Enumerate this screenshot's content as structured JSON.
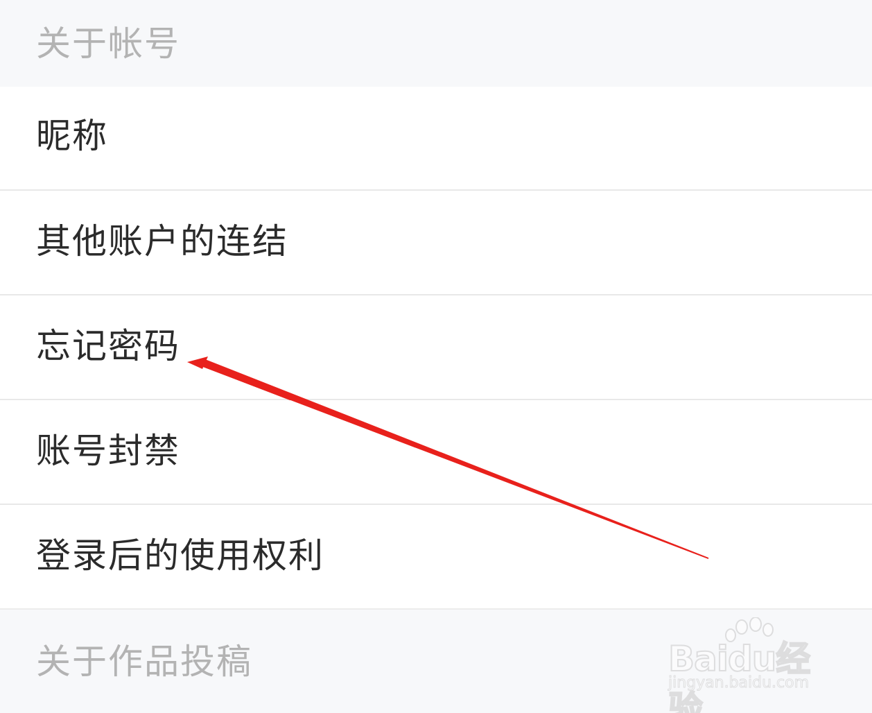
{
  "sections": [
    {
      "title": "关于帐号",
      "items": [
        {
          "label": "昵称"
        },
        {
          "label": "其他账户的连结"
        },
        {
          "label": "忘记密码"
        },
        {
          "label": "账号封禁"
        },
        {
          "label": "登录后的使用权利"
        }
      ]
    },
    {
      "title": "关于作品投稿",
      "items": []
    }
  ],
  "annotation": {
    "type": "arrow",
    "color": "#e8211c",
    "points_to": "忘记密码"
  },
  "watermark": {
    "brand": "Baidu经验",
    "sub": "jingyan.baidu.com"
  }
}
